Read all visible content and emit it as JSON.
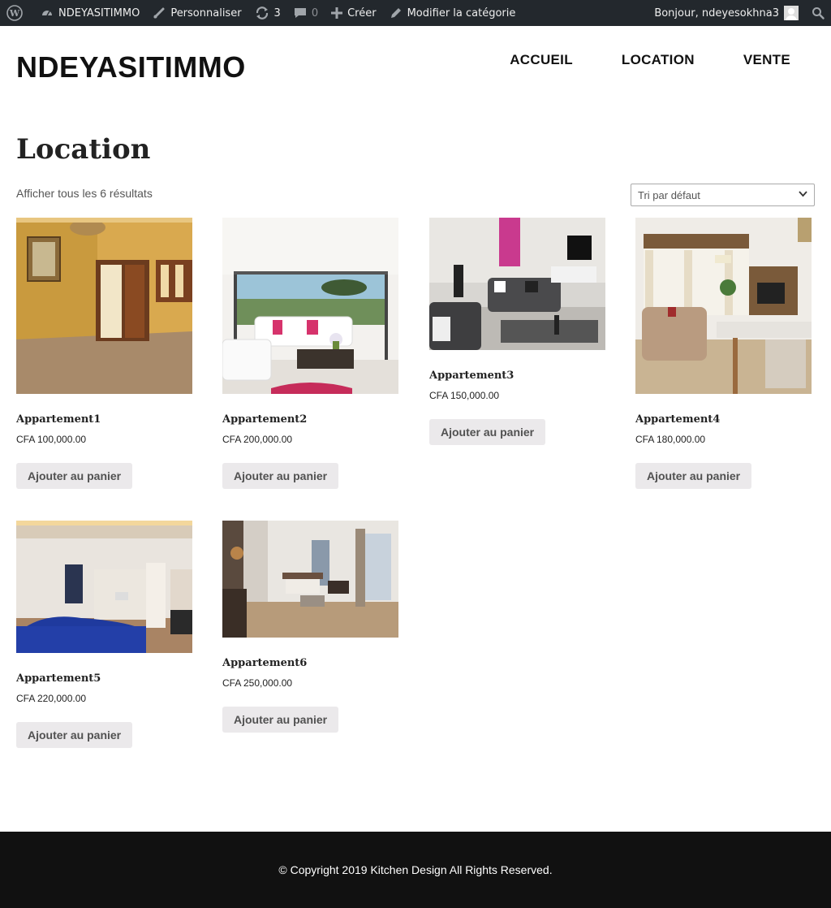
{
  "adminbar": {
    "site_name": "NDEYASITIMMO",
    "customize": "Personnaliser",
    "updates": "3",
    "comments": "0",
    "new": "Créer",
    "edit": "Modifier la catégorie",
    "greeting": "Bonjour, ndeyesokhna3"
  },
  "header": {
    "site_title": "NDEYASITIMMO",
    "nav": [
      "ACCUEIL",
      "LOCATION",
      "VENTE"
    ]
  },
  "page": {
    "title": "Location",
    "result_count": "Afficher tous les 6 résultats",
    "ordering_selected": "Tri par défaut"
  },
  "products": [
    {
      "title": "Appartement1",
      "price": "CFA 100,000.00",
      "button": "Ajouter au panier"
    },
    {
      "title": "Appartement2",
      "price": "CFA 200,000.00",
      "button": "Ajouter au panier"
    },
    {
      "title": "Appartement3",
      "price": "CFA 150,000.00",
      "button": "Ajouter au panier"
    },
    {
      "title": "Appartement4",
      "price": "CFA 180,000.00",
      "button": "Ajouter au panier"
    },
    {
      "title": "Appartement5",
      "price": "CFA 220,000.00",
      "button": "Ajouter au panier"
    },
    {
      "title": "Appartement6",
      "price": "CFA 250,000.00",
      "button": "Ajouter au panier"
    }
  ],
  "footer": {
    "copyright": "© Copyright 2019 Kitchen Design All Rights Reserved."
  },
  "colors": {
    "adminbar_bg": "#23282d",
    "footer_bg": "#111111",
    "button_bg": "#ebe9eb"
  }
}
